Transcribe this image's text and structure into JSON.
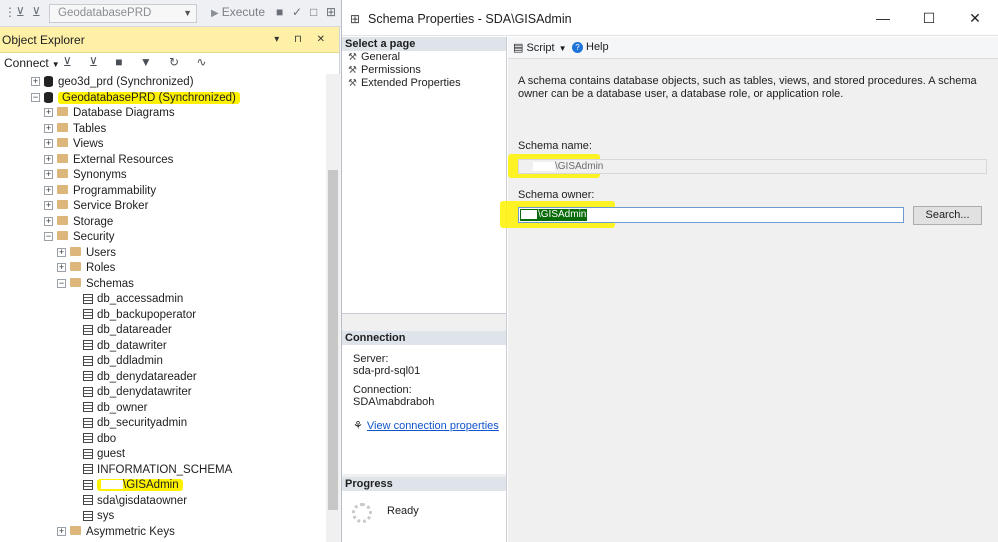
{
  "toolbar": {
    "database": "GeodatabasePRD",
    "execute_label": "Execute"
  },
  "object_explorer": {
    "title": "Object Explorer",
    "connect_label": "Connect",
    "tree": [
      {
        "label": "geo3d_prd (Synchronized)",
        "indent": 0,
        "type": "db",
        "expander": "+"
      },
      {
        "label": "GeodatabasePRD (Synchronized)",
        "indent": 0,
        "type": "db",
        "expander": "-",
        "highlight": true
      },
      {
        "label": "Database Diagrams",
        "indent": 1,
        "type": "folder",
        "expander": "+"
      },
      {
        "label": "Tables",
        "indent": 1,
        "type": "folder",
        "expander": "+"
      },
      {
        "label": "Views",
        "indent": 1,
        "type": "folder",
        "expander": "+"
      },
      {
        "label": "External Resources",
        "indent": 1,
        "type": "folder",
        "expander": "+"
      },
      {
        "label": "Synonyms",
        "indent": 1,
        "type": "folder",
        "expander": "+"
      },
      {
        "label": "Programmability",
        "indent": 1,
        "type": "folder",
        "expander": "+"
      },
      {
        "label": "Service Broker",
        "indent": 1,
        "type": "folder",
        "expander": "+"
      },
      {
        "label": "Storage",
        "indent": 1,
        "type": "folder",
        "expander": "+"
      },
      {
        "label": "Security",
        "indent": 1,
        "type": "folder",
        "expander": "-"
      },
      {
        "label": "Users",
        "indent": 2,
        "type": "folder",
        "expander": "+"
      },
      {
        "label": "Roles",
        "indent": 2,
        "type": "folder",
        "expander": "+"
      },
      {
        "label": "Schemas",
        "indent": 2,
        "type": "folder",
        "expander": "-"
      },
      {
        "label": "db_accessadmin",
        "indent": 3,
        "type": "schema"
      },
      {
        "label": "db_backupoperator",
        "indent": 3,
        "type": "schema"
      },
      {
        "label": "db_datareader",
        "indent": 3,
        "type": "schema"
      },
      {
        "label": "db_datawriter",
        "indent": 3,
        "type": "schema"
      },
      {
        "label": "db_ddladmin",
        "indent": 3,
        "type": "schema"
      },
      {
        "label": "db_denydatareader",
        "indent": 3,
        "type": "schema"
      },
      {
        "label": "db_denydatawriter",
        "indent": 3,
        "type": "schema"
      },
      {
        "label": "db_owner",
        "indent": 3,
        "type": "schema"
      },
      {
        "label": "db_securityadmin",
        "indent": 3,
        "type": "schema"
      },
      {
        "label": "dbo",
        "indent": 3,
        "type": "schema"
      },
      {
        "label": "guest",
        "indent": 3,
        "type": "schema"
      },
      {
        "label": "INFORMATION_SCHEMA",
        "indent": 3,
        "type": "schema"
      },
      {
        "label": "\\GISAdmin",
        "indent": 3,
        "type": "schema",
        "highlight": true,
        "redacted": true
      },
      {
        "label": "sda\\gisdataowner",
        "indent": 3,
        "type": "schema"
      },
      {
        "label": "sys",
        "indent": 3,
        "type": "schema"
      },
      {
        "label": "Asymmetric Keys",
        "indent": 2,
        "type": "folder",
        "expander": "+"
      }
    ]
  },
  "dialog": {
    "title": "Schema Properties - SDA\\GISAdmin",
    "select_page_header": "Select a page",
    "pages": [
      "General",
      "Permissions",
      "Extended Properties"
    ],
    "toolbar": {
      "script_label": "Script",
      "help_label": "Help"
    },
    "description": "A schema contains database objects, such as tables, views, and stored procedures. A schema owner can be a database user, a database role, or application role.",
    "schema_name_label": "Schema name:",
    "schema_name_value": "\\GISAdmin",
    "schema_owner_label": "Schema owner:",
    "schema_owner_value": "\\GISAdmin",
    "search_button": "Search...",
    "connection": {
      "header": "Connection",
      "server_label": "Server:",
      "server_value": "sda-prd-sql01",
      "connection_label": "Connection:",
      "connection_value": "SDA\\mabdraboh",
      "link": "View connection properties"
    },
    "progress": {
      "header": "Progress",
      "status": "Ready"
    }
  }
}
